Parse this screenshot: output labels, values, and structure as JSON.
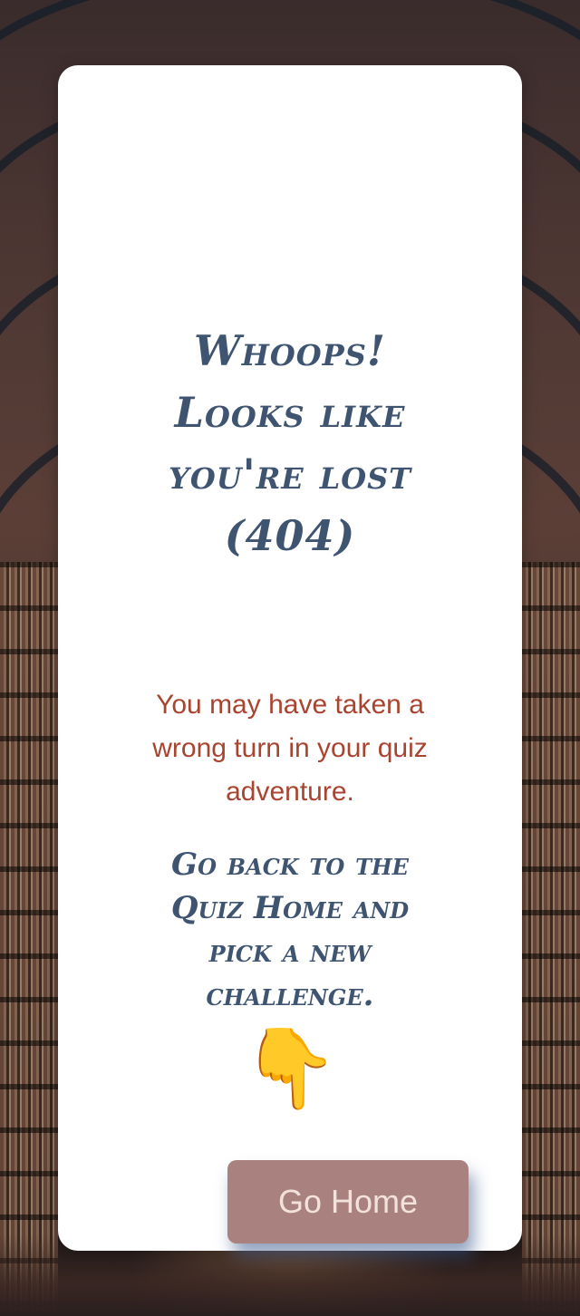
{
  "error": {
    "heading": "Whoops! Looks like you're lost (404)",
    "message": "You may have taken a wrong turn in your quiz adventure.",
    "instruction": "Go back to the Quiz Home and pick a new challenge.",
    "pointer_icon": "👇",
    "pointer_icon_name": "pointing-down-hand-icon"
  },
  "actions": {
    "home_button_label": "Go Home"
  },
  "colors": {
    "heading": "#3e5470",
    "message": "#a8442f",
    "button_bg": "#a9817e",
    "button_text": "#f3e2dc",
    "card_bg": "#ffffff"
  }
}
